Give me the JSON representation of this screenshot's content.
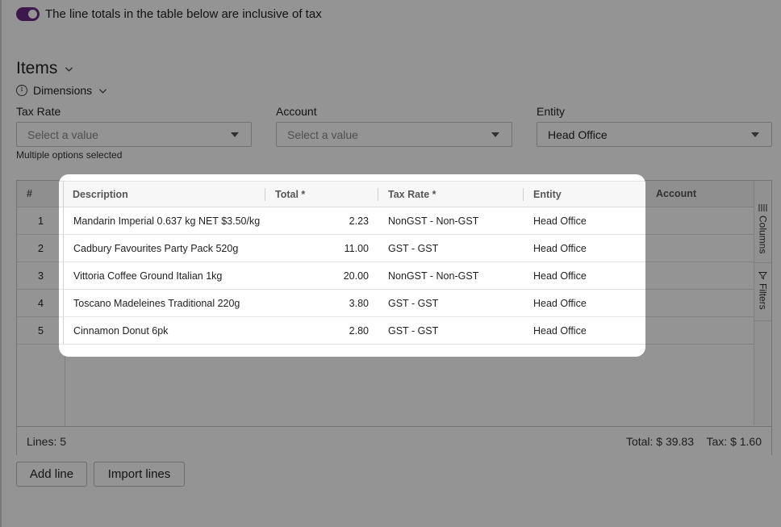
{
  "toggle": {
    "on": true,
    "label": "The line totals in the table below are inclusive of tax"
  },
  "items": {
    "title": "Items"
  },
  "dimensions": {
    "info_glyph": "i",
    "label": "Dimensions"
  },
  "filters": {
    "tax_rate": {
      "label": "Tax Rate",
      "placeholder": "Select a value",
      "note": "Multiple options selected"
    },
    "account": {
      "label": "Account",
      "placeholder": "Select a value"
    },
    "entity": {
      "label": "Entity",
      "value": "Head Office"
    }
  },
  "grid": {
    "columns": {
      "num": "#",
      "description": "Description",
      "total": "Total *",
      "tax_rate": "Tax Rate *",
      "entity": "Entity",
      "account": "Account"
    },
    "rows": [
      {
        "num": "1",
        "description": "Mandarin Imperial 0.637 kg NET $3.50/kg",
        "total": "2.23",
        "tax_rate": "NonGST - Non-GST",
        "entity": "Head Office",
        "account": ""
      },
      {
        "num": "2",
        "description": "Cadbury Favourites Party Pack 520g",
        "total": "11.00",
        "tax_rate": "GST - GST",
        "entity": "Head Office",
        "account": ""
      },
      {
        "num": "3",
        "description": "Vittoria Coffee Ground Italian 1kg",
        "total": "20.00",
        "tax_rate": "NonGST - Non-GST",
        "entity": "Head Office",
        "account": ""
      },
      {
        "num": "4",
        "description": "Toscano Madeleines Traditional 220g",
        "total": "3.80",
        "tax_rate": "GST - GST",
        "entity": "Head Office",
        "account": ""
      },
      {
        "num": "5",
        "description": "Cinnamon Donut 6pk",
        "total": "2.80",
        "tax_rate": "GST - GST",
        "entity": "Head Office",
        "account": ""
      }
    ],
    "side_tabs": {
      "columns": "Columns",
      "filters": "Filters"
    },
    "footer": {
      "lines": "Lines: 5",
      "total": "Total: $ 39.83",
      "tax": "Tax: $ 1.60"
    }
  },
  "buttons": {
    "add_line": "Add line",
    "import_lines": "Import lines"
  },
  "colors": {
    "accent": "#6a2a83",
    "overlay": "rgba(0,0,0,0.42)"
  }
}
